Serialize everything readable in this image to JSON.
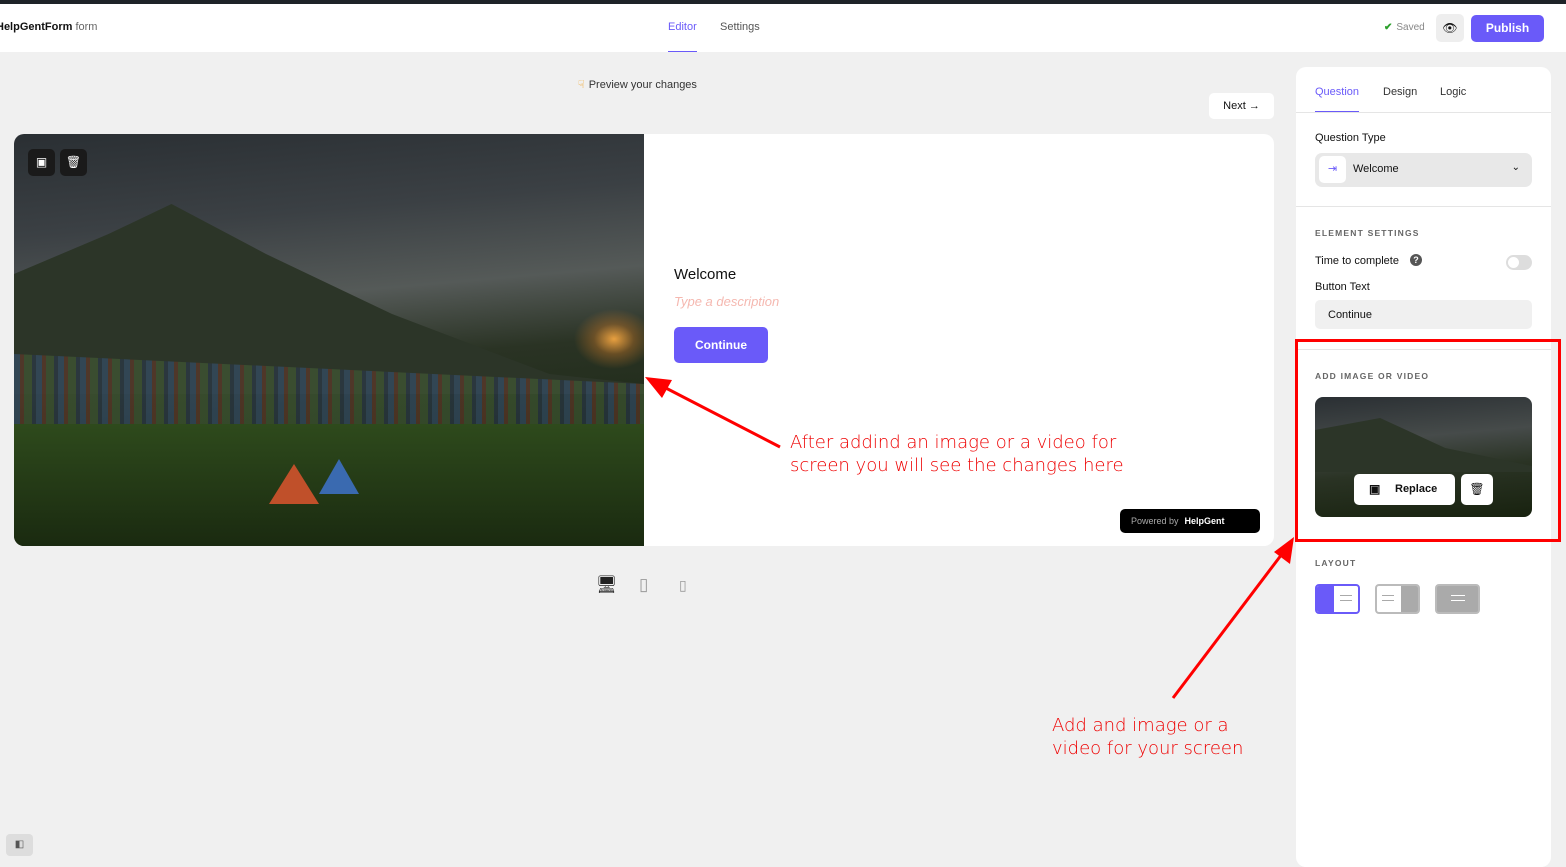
{
  "header": {
    "brand_bold": "HelpGentForm",
    "brand_rest": "form",
    "tabs": [
      "Editor",
      "Settings"
    ],
    "saved": "Saved",
    "publish": "Publish"
  },
  "canvas": {
    "preview_hint": "Preview your changes",
    "next": "Next",
    "title": "Welcome",
    "description_placeholder": "Type a description",
    "continue": "Continue",
    "powered_by": "Powered by",
    "powered_brand": "HelpGent"
  },
  "panel": {
    "tabs": [
      "Question",
      "Design",
      "Logic"
    ],
    "question_type_label": "Question Type",
    "question_type_value": "Welcome",
    "element_settings": "ELEMENT SETTINGS",
    "time_to_complete": "Time to complete",
    "time_to_complete_enabled": false,
    "button_text_label": "Button Text",
    "button_text_value": "Continue",
    "add_media": "ADD IMAGE OR VIDEO",
    "replace": "Replace",
    "layout": "LAYOUT",
    "layout_selected": "image-left"
  },
  "annotations": {
    "preview": "After addind an image or a video for screen you will see the changes here",
    "panel": "Add and image or a video for your screen"
  },
  "colors": {
    "accent": "#6a5af9",
    "annotation": "#ff0000"
  }
}
